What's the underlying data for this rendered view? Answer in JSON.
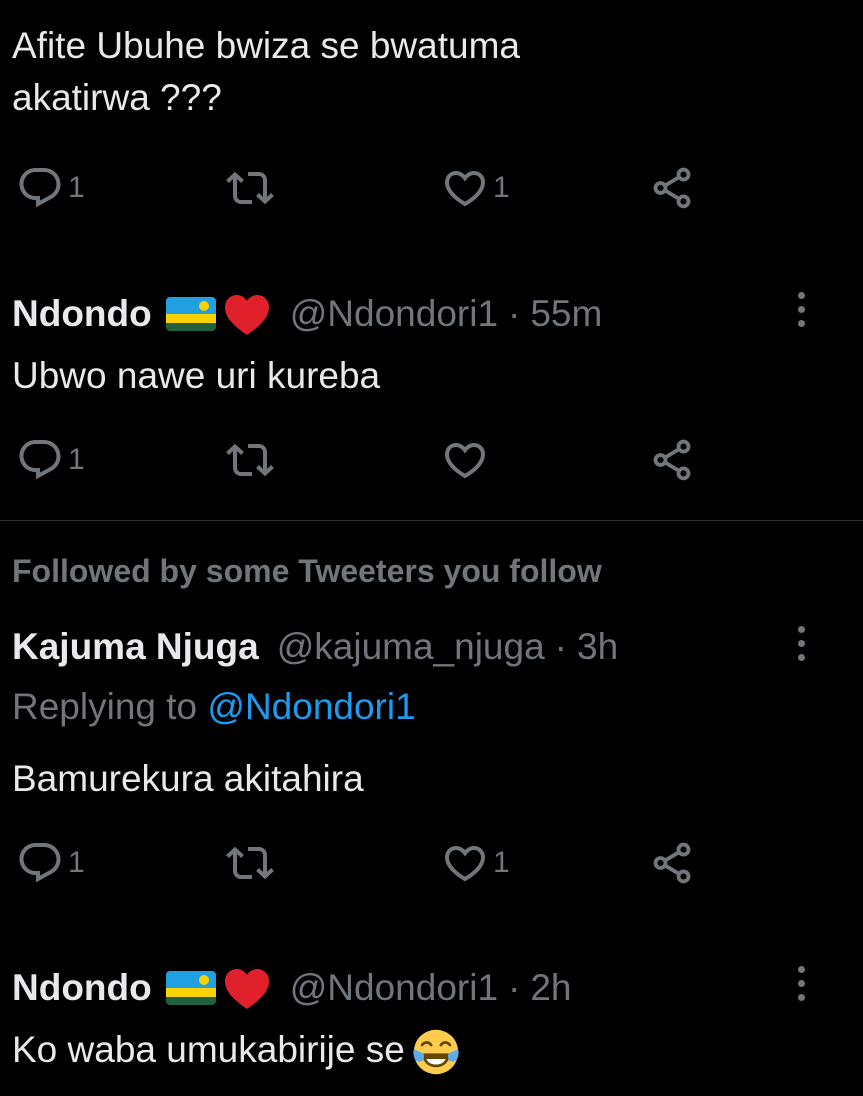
{
  "top_tweet": {
    "text_line1": "Afite Ubuhe bwiza se bwatuma",
    "text_line2": "akatirwa ???",
    "reply_count": "1",
    "like_count": "1"
  },
  "tweet_2": {
    "name": "Ndondo",
    "handle": "@Ndondori1",
    "separator": "·",
    "time": "55m",
    "text": "Ubwo nawe uri kureba",
    "reply_count": "1",
    "like_count": ""
  },
  "social_context": "Followed by some Tweeters you follow",
  "tweet_3": {
    "name": "Kajuma Njuga",
    "handle": "@kajuma_njuga",
    "separator": "·",
    "time": "3h",
    "replying_label": "Replying to",
    "replying_mention": "@Ndondori1",
    "text": "Bamurekura akitahira",
    "reply_count": "1",
    "like_count": "1"
  },
  "tweet_4": {
    "name": "Ndondo",
    "handle": "@Ndondori1",
    "separator": "·",
    "time": "2h",
    "text": "Ko waba umukabirije se"
  },
  "icons": {
    "reply": "reply-icon",
    "retweet": "retweet-icon",
    "like": "heart-icon",
    "share": "share-icon",
    "more": "more-icon"
  },
  "colors": {
    "background": "#000000",
    "text_primary": "#e7e9ea",
    "text_secondary": "#71767b",
    "link": "#1d9bf0",
    "divider": "#2f3336"
  }
}
